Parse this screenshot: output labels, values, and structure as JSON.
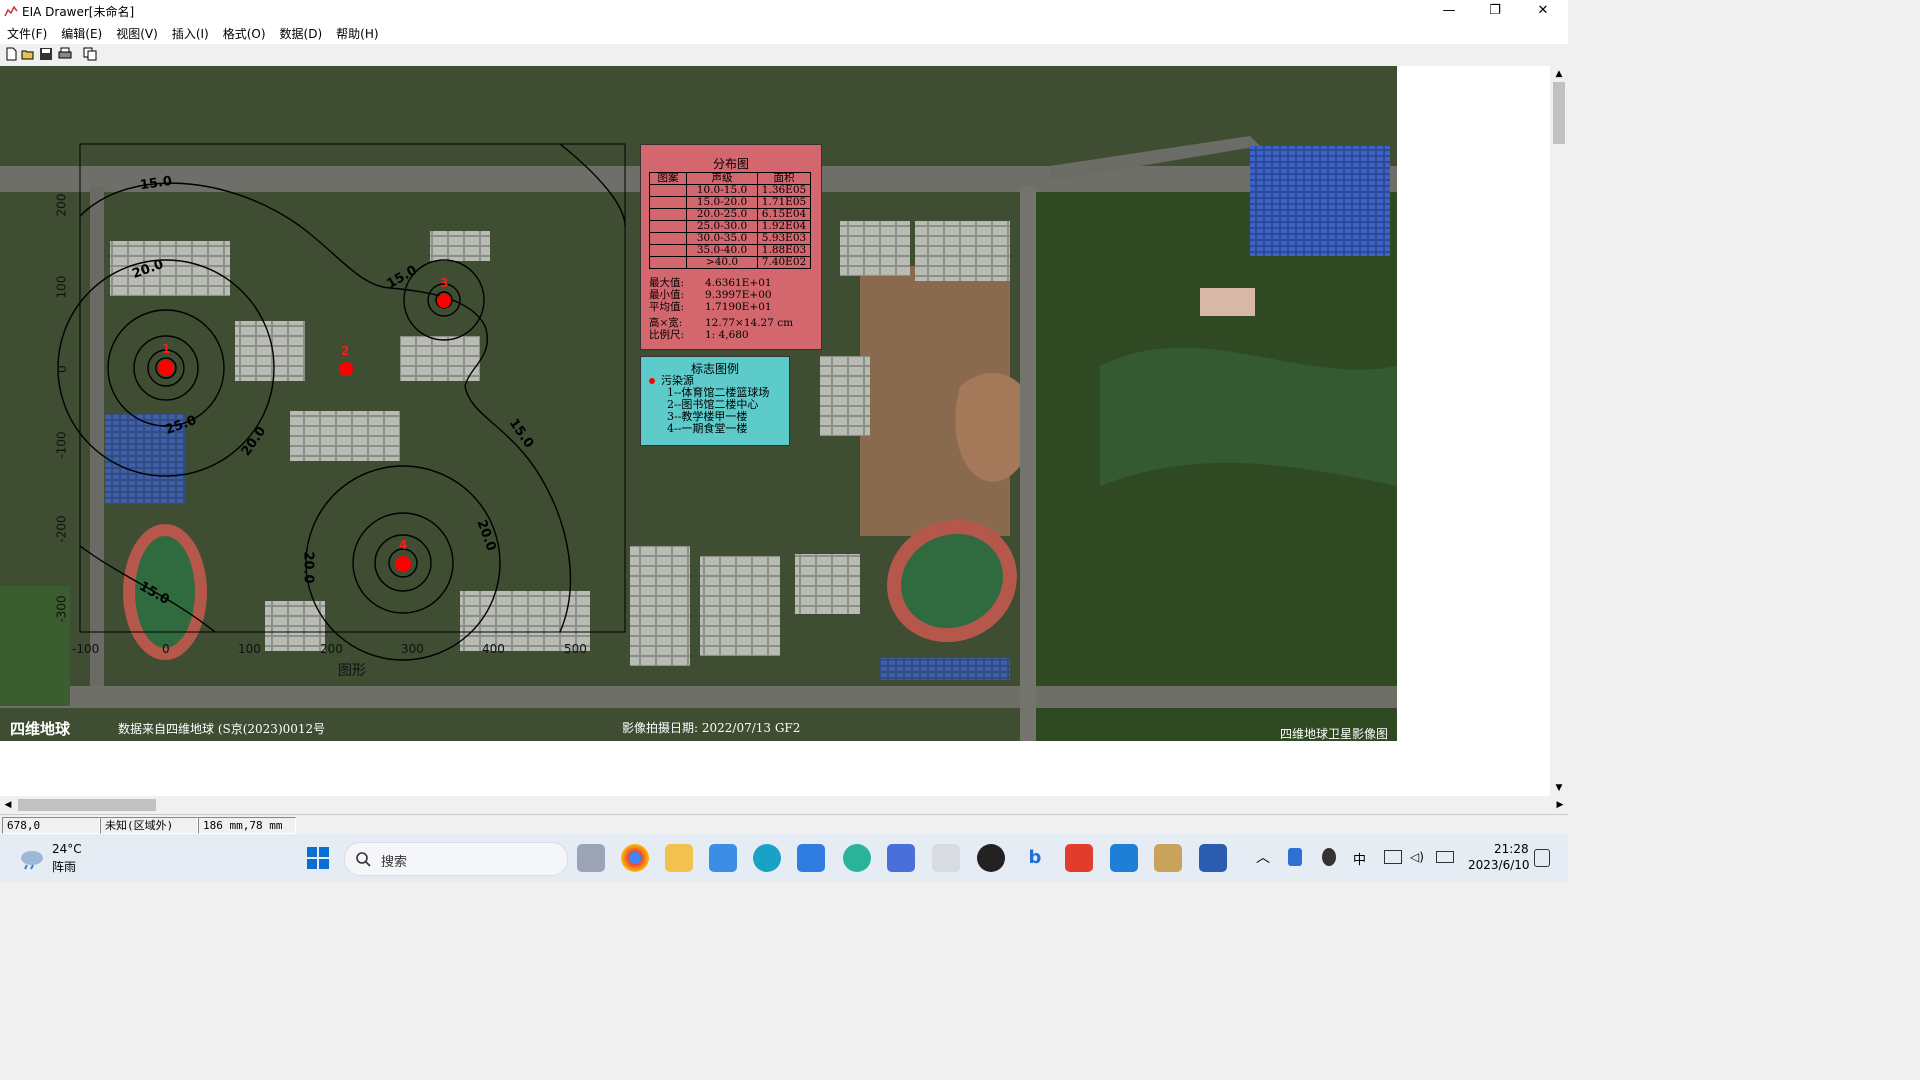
{
  "window": {
    "title": "EIA Drawer[未命名]",
    "minimize": "—",
    "restore": "❐",
    "close": "✕"
  },
  "menu": [
    "文件(F)",
    "编辑(E)",
    "视图(V)",
    "插入(I)",
    "格式(O)",
    "数据(D)",
    "帮助(H)"
  ],
  "toolbar_icons": [
    "new-file-icon",
    "open-folder-icon",
    "save-icon",
    "print-icon",
    "copy-icon"
  ],
  "map": {
    "x_ticks": [
      "-100",
      "0",
      "100",
      "200",
      "300",
      "400",
      "500"
    ],
    "y_ticks": [
      "200",
      "100",
      "0",
      "-100",
      "-200",
      "-300"
    ],
    "xlabel": "图形",
    "contour_labels": [
      "15.0",
      "20.0",
      "15.0",
      "25.0",
      "20.0",
      "15.0",
      "20.0",
      "20.0",
      "15.0"
    ],
    "source_labels": [
      "1",
      "2",
      "3",
      "4"
    ],
    "watermark_left": "四维地球",
    "credit": "数据来自四维地球 (S京(2023)0012号",
    "date_text": "影像拍摄日期: 2022/07/13 GF2",
    "watermark_right": "四维地球卫星影像图"
  },
  "distribution": {
    "title": "分布图",
    "headers": [
      "图案",
      "声级",
      "面积"
    ],
    "rows": [
      {
        "level": "10.0-15.0",
        "area": "1.36E05"
      },
      {
        "level": "15.0-20.0",
        "area": "1.71E05"
      },
      {
        "level": "20.0-25.0",
        "area": "6.15E04"
      },
      {
        "level": "25.0-30.0",
        "area": "1.92E04"
      },
      {
        "level": "30.0-35.0",
        "area": "5.93E03"
      },
      {
        "level": "35.0-40.0",
        "area": "1.88E03"
      },
      {
        "level": ">40.0",
        "area": "7.40E02"
      }
    ],
    "stats": [
      {
        "label": "最大值:",
        "value": "4.6361E+01"
      },
      {
        "label": "最小值:",
        "value": "9.3997E+00"
      },
      {
        "label": "平均值:",
        "value": "1.7190E+01"
      },
      {
        "label": "高×宽:",
        "value": "12.77×14.27 cm"
      },
      {
        "label": "比例尺:",
        "value": "1: 4,680"
      }
    ]
  },
  "legend": {
    "title": "标志图例",
    "category": "污染源",
    "items": [
      "1--体育馆二楼篮球场",
      "2--图书馆二楼中心",
      "3--教学楼甲一楼",
      "4--一期食堂一楼"
    ]
  },
  "status": {
    "coords": "678,0",
    "region": "未知(区域外)",
    "size": "186 mm,78 mm"
  },
  "taskbar": {
    "weather_temp": "24°C",
    "weather_desc": "阵雨",
    "search_placeholder": "搜索",
    "ime": "中",
    "time": "21:28",
    "date": "2023/6/10"
  },
  "colors": {
    "distribution_bg": "#d4676e",
    "legend_bg": "#5ecbcb",
    "source": "#ff0000"
  }
}
